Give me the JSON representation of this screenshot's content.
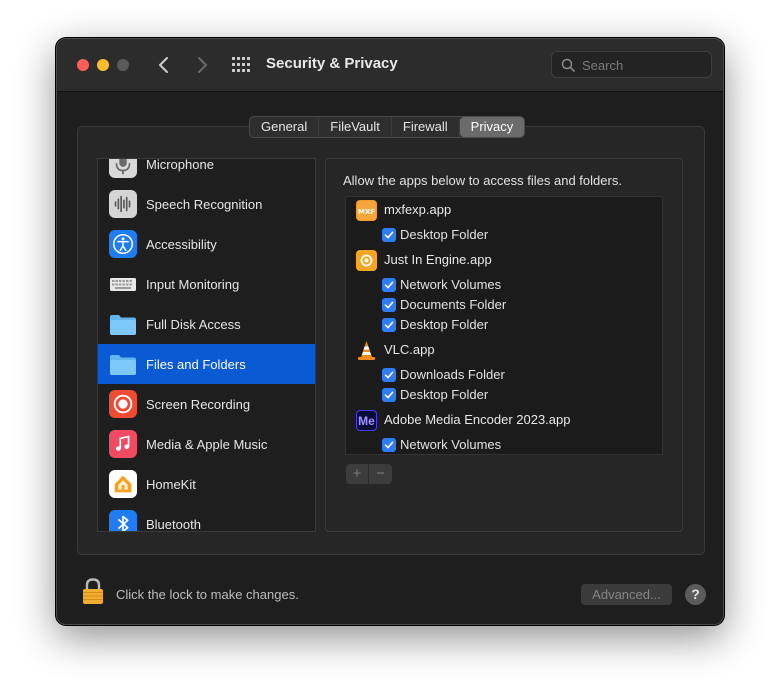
{
  "window": {
    "title": "Security & Privacy"
  },
  "search": {
    "placeholder": "Search"
  },
  "tabs": [
    {
      "label": "General"
    },
    {
      "label": "FileVault"
    },
    {
      "label": "Firewall"
    },
    {
      "label": "Privacy",
      "active": true
    }
  ],
  "sidebar": {
    "items": [
      {
        "label": "Microphone",
        "icon": "microphone-icon"
      },
      {
        "label": "Speech Recognition",
        "icon": "waveform-icon"
      },
      {
        "label": "Accessibility",
        "icon": "accessibility-icon"
      },
      {
        "label": "Input Monitoring",
        "icon": "keyboard-icon"
      },
      {
        "label": "Full Disk Access",
        "icon": "folder-icon"
      },
      {
        "label": "Files and Folders",
        "icon": "folder-icon",
        "selected": true
      },
      {
        "label": "Screen Recording",
        "icon": "screen-recording-icon"
      },
      {
        "label": "Media & Apple Music",
        "icon": "music-icon"
      },
      {
        "label": "HomeKit",
        "icon": "home-icon"
      },
      {
        "label": "Bluetooth",
        "icon": "bluetooth-icon"
      }
    ]
  },
  "panel": {
    "description": "Allow the apps below to access files and folders.",
    "apps": [
      {
        "name": "mxfexp.app",
        "icon": "mxf-app-icon",
        "permissions": [
          "Desktop Folder"
        ]
      },
      {
        "name": "Just In Engine.app",
        "icon": "engine-app-icon",
        "permissions": [
          "Network Volumes",
          "Documents Folder",
          "Desktop Folder"
        ]
      },
      {
        "name": "VLC.app",
        "icon": "vlc-cone-icon",
        "permissions": [
          "Downloads Folder",
          "Desktop Folder"
        ]
      },
      {
        "name": "Adobe Media Encoder 2023.app",
        "icon": "media-encoder-icon",
        "icon_text": "Me",
        "permissions": [
          "Network Volumes"
        ]
      }
    ],
    "add_label": "+",
    "remove_label": "−"
  },
  "footer": {
    "lock_text": "Click the lock to make changes.",
    "advanced_label": "Advanced...",
    "help_label": "?"
  },
  "colors": {
    "selection": "#0a5ad4",
    "checkbox": "#2f7cf6",
    "window_bg": "#1e1e1e"
  }
}
